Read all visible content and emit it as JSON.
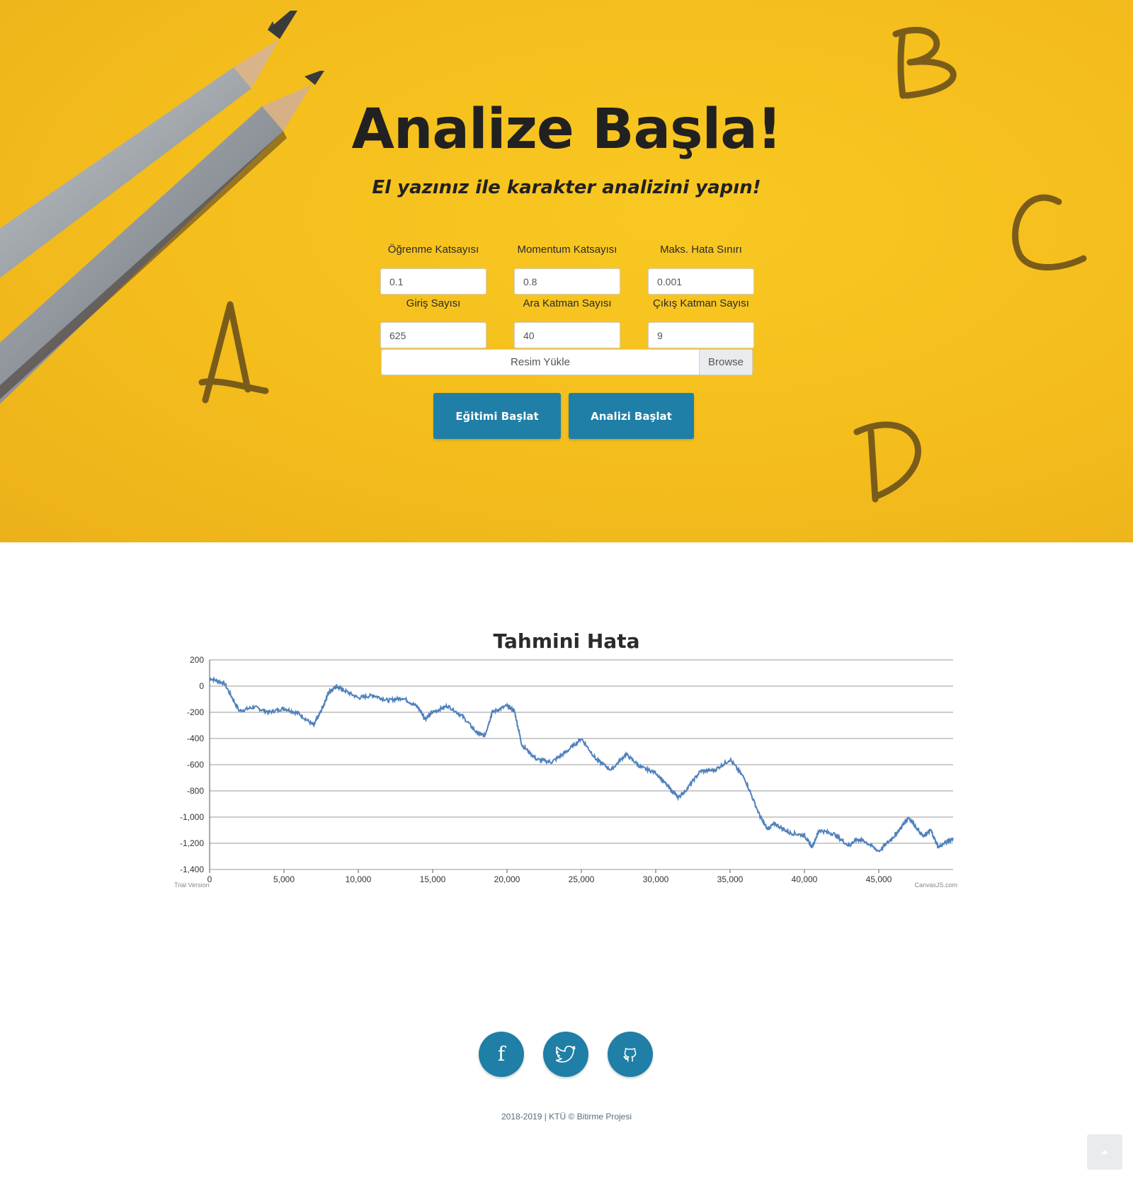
{
  "hero": {
    "title": "Analize Başla!",
    "subtitle": "El yazınız ile karakter analizini yapın!",
    "letters": [
      "A",
      "B",
      "C",
      "D"
    ]
  },
  "form": {
    "learning_rate": {
      "label": "Öğrenme Katsayısı",
      "value": "0.1"
    },
    "momentum": {
      "label": "Momentum Katsayısı",
      "value": "0.8"
    },
    "max_error": {
      "label": "Maks. Hata Sınırı",
      "value": "0.001"
    },
    "input_count": {
      "label": "Giriş Sayısı",
      "value": "625"
    },
    "hidden_count": {
      "label": "Ara Katman Sayısı",
      "value": "40"
    },
    "output_count": {
      "label": "Çıkış Katman Sayısı",
      "value": "9"
    },
    "upload": {
      "label": "Resim Yükle",
      "browse": "Browse"
    },
    "train_button": "Eğitimi Başlat",
    "analyze_button": "Analizi Başlat"
  },
  "chart_data": {
    "type": "line",
    "title": "Tahmini Hata",
    "xlabel": "",
    "ylabel": "",
    "xlim": [
      0,
      50000
    ],
    "ylim": [
      -1400,
      200
    ],
    "xticks": [
      0,
      5000,
      10000,
      15000,
      20000,
      25000,
      30000,
      35000,
      40000,
      45000
    ],
    "xtick_labels": [
      "0",
      "5,000",
      "10,000",
      "15,000",
      "20,000",
      "25,000",
      "30,000",
      "35,000",
      "40,000",
      "45,000"
    ],
    "yticks": [
      200,
      0,
      -200,
      -400,
      -600,
      -800,
      -1000,
      -1200,
      -1400
    ],
    "ytick_labels": [
      "200",
      "0",
      "-200",
      "-400",
      "-600",
      "-800",
      "-1,000",
      "-1,200",
      "-1,400"
    ],
    "grid": true,
    "series_color": "#4f81bc",
    "watermark_left": "Trial Version",
    "watermark_right": "CanvasJS.com",
    "series": [
      {
        "x": [
          0,
          1000,
          2000,
          3000,
          4000,
          5000,
          6000,
          7000,
          7500,
          8000,
          8500,
          9000,
          10000,
          11000,
          12000,
          13000,
          14000,
          14500,
          15000,
          16000,
          17000,
          18000,
          18500,
          19000,
          20000,
          20500,
          21000,
          22000,
          23000,
          24000,
          25000,
          26000,
          27000,
          28000,
          29000,
          30000,
          31000,
          31500,
          32000,
          33000,
          34000,
          35000,
          36000,
          37000,
          37500,
          38000,
          39000,
          40000,
          40500,
          41000,
          42000,
          43000,
          43500,
          44000,
          45000,
          46000,
          46500,
          47000,
          48000,
          48500,
          49000,
          50000
        ],
        "y": [
          60,
          20,
          -190,
          -160,
          -200,
          -170,
          -210,
          -300,
          -190,
          -50,
          0,
          -30,
          -90,
          -70,
          -110,
          -90,
          -160,
          -250,
          -200,
          -150,
          -230,
          -360,
          -380,
          -200,
          -150,
          -190,
          -450,
          -560,
          -580,
          -500,
          -400,
          -560,
          -640,
          -520,
          -620,
          -660,
          -790,
          -850,
          -800,
          -650,
          -640,
          -560,
          -710,
          -990,
          -1090,
          -1050,
          -1120,
          -1140,
          -1230,
          -1100,
          -1130,
          -1220,
          -1170,
          -1180,
          -1260,
          -1150,
          -1080,
          -1000,
          -1150,
          -1100,
          -1230,
          -1160
        ]
      }
    ]
  },
  "social": {
    "facebook_glyph": "f",
    "twitter_icon": "twitter-icon",
    "github_icon": "github-icon"
  },
  "footer": {
    "text": "2018-2019 | KTÜ © Bitirme Projesi"
  }
}
